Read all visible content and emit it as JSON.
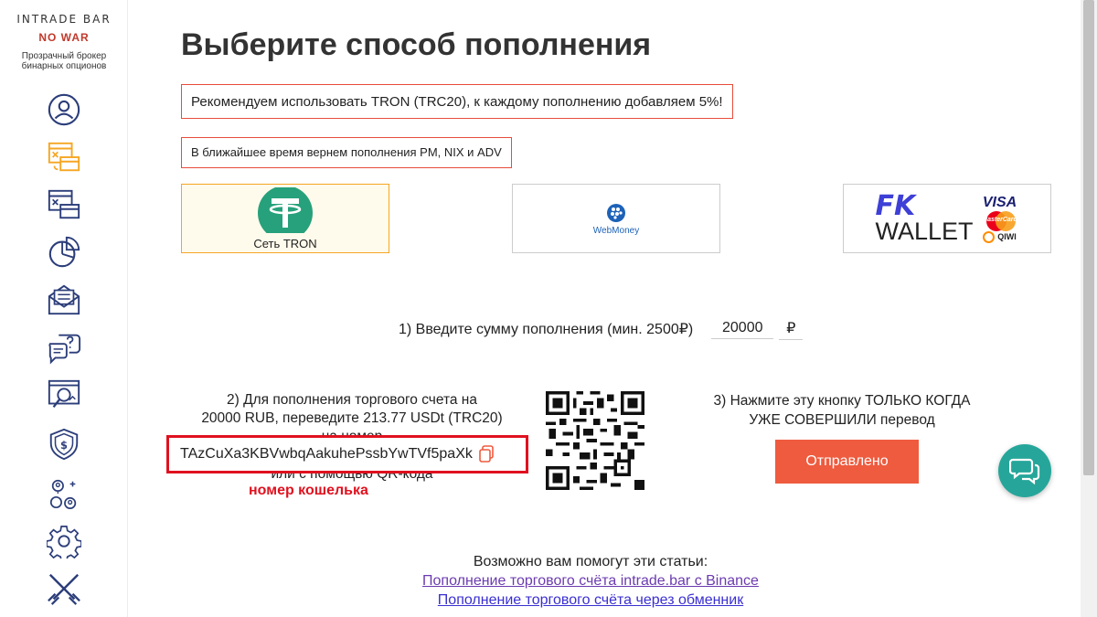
{
  "brand": {
    "logo_text": "INTRADE BAR",
    "slogan": "NO WAR",
    "tagline_line1": "Прозрачный брокер",
    "tagline_line2": "бинарных опционов"
  },
  "sidebar": {
    "items": [
      {
        "name": "profile",
        "icon": "user-icon"
      },
      {
        "name": "deposit",
        "icon": "deposit-icon",
        "active": true
      },
      {
        "name": "withdraw",
        "icon": "withdraw-icon"
      },
      {
        "name": "statistics",
        "icon": "pie-chart-icon"
      },
      {
        "name": "messages",
        "icon": "mail-icon"
      },
      {
        "name": "support",
        "icon": "question-chat-icon"
      },
      {
        "name": "analytics",
        "icon": "search-chart-icon"
      },
      {
        "name": "security",
        "icon": "shield-dollar-icon"
      },
      {
        "name": "referral",
        "icon": "referral-icon"
      },
      {
        "name": "settings",
        "icon": "gear-icon"
      },
      {
        "name": "tournaments",
        "icon": "crossed-swords-icon"
      }
    ]
  },
  "page": {
    "title": "Выберите способ пополнения",
    "notice_recommend": "Рекомендуем использовать TRON (TRC20), к каждому пополнению добавляем 5%!",
    "notice_soon": "В ближайшее время вернем пополнения PM, NIX и ADV"
  },
  "methods": [
    {
      "label": "Сеть TRON",
      "selected": true
    },
    {
      "label": "WebMoney",
      "selected": false
    },
    {
      "label": "FK WALLET",
      "extra": [
        "VISA",
        "MasterCard",
        "QIWI"
      ],
      "selected": false
    }
  ],
  "step1": {
    "label": "1) Введите сумму пополнения (мин. 2500₽)",
    "amount": "20000",
    "currency": "₽"
  },
  "step2": {
    "line1": "2) Для пополнения торгового счета на",
    "line2": "20000 RUB, переведите 213.77 USDt (TRC20)",
    "line3": "на номер",
    "address": "TAzCuXa3KBVwbqAakuhePssbYwTVf5paXk",
    "line4": "или с помощью QR-кода",
    "annotation": "номер кошелька"
  },
  "step3": {
    "line1": "3) Нажмите эту кнопку ТОЛЬКО КОГДА",
    "line2": "УЖЕ СОВЕРШИЛИ перевод",
    "button": "Отправлено"
  },
  "articles": {
    "title": "Возможно вам помогут эти статьи:",
    "links": [
      "Пополнение торгового счёта intrade.bar с Binance",
      "Пополнение торгового счёта через обменник"
    ]
  },
  "colors": {
    "accent_orange": "#ee5b3f",
    "notice_border": "#e74c3c",
    "annotation_red": "#e0111f",
    "tron_green": "#26a17b",
    "chat_teal": "#26a69a",
    "icon_navy": "#2c3e7a",
    "icon_orange": "#f5a623"
  }
}
